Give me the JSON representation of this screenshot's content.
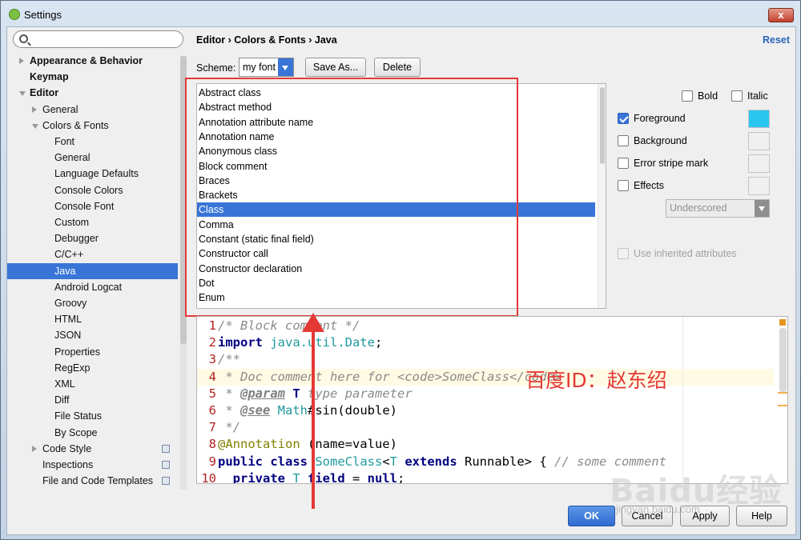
{
  "window": {
    "title": "Settings",
    "close": "x"
  },
  "sidebar": {
    "search_placeholder": "",
    "items": [
      {
        "label": "Appearance & Behavior"
      },
      {
        "label": "Keymap"
      },
      {
        "label": "Editor"
      },
      {
        "label": "General"
      },
      {
        "label": "Colors & Fonts"
      },
      {
        "label": "Font"
      },
      {
        "label": "General"
      },
      {
        "label": "Language Defaults"
      },
      {
        "label": "Console Colors"
      },
      {
        "label": "Console Font"
      },
      {
        "label": "Custom"
      },
      {
        "label": "Debugger"
      },
      {
        "label": "C/C++"
      },
      {
        "label": "Java"
      },
      {
        "label": "Android Logcat"
      },
      {
        "label": "Groovy"
      },
      {
        "label": "HTML"
      },
      {
        "label": "JSON"
      },
      {
        "label": "Properties"
      },
      {
        "label": "RegExp"
      },
      {
        "label": "XML"
      },
      {
        "label": "Diff"
      },
      {
        "label": "File Status"
      },
      {
        "label": "By Scope"
      },
      {
        "label": "Code Style"
      },
      {
        "label": "Inspections"
      },
      {
        "label": "File and Code Templates"
      }
    ]
  },
  "header": {
    "breadcrumb": "Editor › Colors & Fonts › Java",
    "reset": "Reset"
  },
  "scheme": {
    "label": "Scheme:",
    "value": "my font",
    "save_as": "Save As...",
    "delete": "Delete"
  },
  "attributes": [
    "Abstract class",
    "Abstract method",
    "Annotation attribute name",
    "Annotation name",
    "Anonymous class",
    "Block comment",
    "Braces",
    "Brackets",
    "Class",
    "Comma",
    "Constant (static final field)",
    "Constructor call",
    "Constructor declaration",
    "Dot",
    "Enum"
  ],
  "options": {
    "bold": "Bold",
    "italic": "Italic",
    "foreground": "Foreground",
    "background": "Background",
    "error_stripe": "Error stripe mark",
    "effects": "Effects",
    "effects_type": "Underscored",
    "use_inherited": "Use inherited attributes",
    "foreground_color": "#29c6f0"
  },
  "preview": {
    "lines": [
      {
        "n": "1",
        "parts": [
          [
            "c-comment",
            "/* Block comment */"
          ]
        ]
      },
      {
        "n": "2",
        "parts": [
          [
            "c-kw",
            "import "
          ],
          [
            "c-cls",
            "java.util.Date"
          ],
          [
            "",
            ";"
          ]
        ]
      },
      {
        "n": "3",
        "parts": [
          [
            "c-comment",
            "/**"
          ]
        ]
      },
      {
        "n": "4",
        "parts": [
          [
            "c-comment",
            " * Doc comment here for <code>SomeClass</code>"
          ]
        ]
      },
      {
        "n": "5",
        "parts": [
          [
            "c-comment",
            " * "
          ],
          [
            "c-tag",
            "@param"
          ],
          [
            "c-comment",
            " "
          ],
          [
            "c-kw",
            "T"
          ],
          [
            "c-comment",
            " type parameter"
          ]
        ]
      },
      {
        "n": "6",
        "parts": [
          [
            "c-comment",
            " * "
          ],
          [
            "c-tag",
            "@see"
          ],
          [
            "c-comment",
            " "
          ],
          [
            "c-cls",
            "Math"
          ],
          [
            "",
            "#sin(double)"
          ]
        ]
      },
      {
        "n": "7",
        "parts": [
          [
            "c-comment",
            " */"
          ]
        ]
      },
      {
        "n": "8",
        "parts": [
          [
            "c-ann",
            "@Annotation"
          ],
          [
            "",
            " (name=value)"
          ]
        ]
      },
      {
        "n": "9",
        "parts": [
          [
            "c-kw",
            "public class "
          ],
          [
            "c-cls",
            "SomeClass"
          ],
          [
            "",
            "<"
          ],
          [
            "c-tp",
            "T "
          ],
          [
            "c-kw",
            "extends "
          ],
          [
            "",
            "Runnable> { "
          ],
          [
            "c-comment",
            "// some comment"
          ]
        ]
      },
      {
        "n": "10",
        "parts": [
          [
            "",
            "  "
          ],
          [
            "c-kw",
            "private "
          ],
          [
            "c-tp",
            "T "
          ],
          [
            "c-kw",
            "field"
          ],
          [
            "",
            " = "
          ],
          [
            "c-kw",
            "null"
          ],
          [
            "",
            ";"
          ]
        ]
      }
    ]
  },
  "annotation": {
    "text": "百度ID：赵东绍"
  },
  "footer": {
    "ok": "OK",
    "cancel": "Cancel",
    "apply": "Apply",
    "help": "Help"
  },
  "watermark": {
    "brand": "Baidu经验",
    "url": "jingyan.baidu.com"
  }
}
